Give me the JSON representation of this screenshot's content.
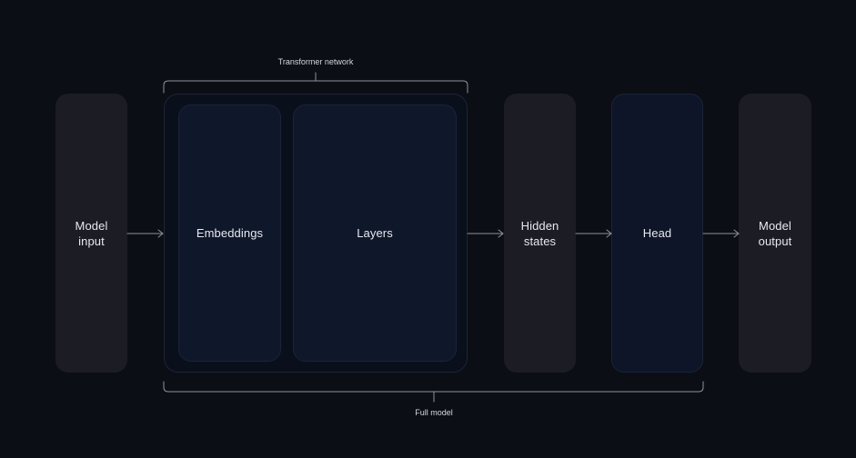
{
  "diagram": {
    "nodes": {
      "model_input": "Model\ninput",
      "embeddings": "Embeddings",
      "layers": "Layers",
      "hidden_states": "Hidden\nstates",
      "head": "Head",
      "model_output": "Model\noutput"
    },
    "brackets": {
      "transformer_network": "Transformer network",
      "full_model": "Full model"
    },
    "colors": {
      "background": "#0c0e15",
      "gray_box": "#1c1d24",
      "navy_box": "#0e1528",
      "line": "#8e929c"
    }
  }
}
